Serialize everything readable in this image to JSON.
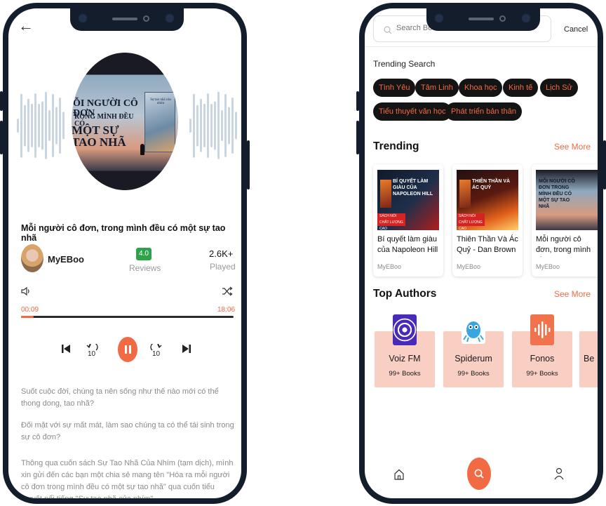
{
  "player": {
    "cover": {
      "line1": "ỖI NGƯỜI CÔ ĐƠN",
      "line2": "RONG MÌNH ĐỀU CÓ",
      "line3": "MỘT SỰ TAO NHÃ"
    },
    "track_title": "Mỗi người cô đơn, trong mình đều có một sự tao nhã",
    "author": "MyEBoo",
    "rating_value": "4.0",
    "rating_label": "Reviews",
    "played_count": "2.6K+",
    "played_label": "Played",
    "time_current": "00:09",
    "time_total": "18:06",
    "progress": 0.06,
    "skip_back_seconds": "10",
    "skip_forward_seconds": "10",
    "description": [
      "Suốt cuộc đời, chúng ta nên sống như thế nào mới có thể thong dong, tao nhã?",
      "Đối mặt với sự mất mát, làm sao chúng ta có thể tái sinh trong sự cô đơn?",
      "Thông qua cuốn sách Sự Tao Nhã Của Nhím (tạm dịch), mình xin gửi đến các bạn một chia sẻ mang tên \"Hóa ra mỗi người cô đơn trong mình đều có một sự tao nhã\" qua cuốn tiểu thuyết nổi tiếng \"Sự tao nhã của nhím\""
    ],
    "accent": "#f26a44",
    "rating_color": "#2fa34a"
  },
  "search": {
    "placeholder": "Search Book & Author Name",
    "cancel_label": "Cancel",
    "trending_search_title": "Trending Search",
    "chips": [
      "Tình Yêu",
      "Tâm Linh",
      "Khoa học",
      "Kinh tế",
      "Lịch Sử",
      "Tiểu thuyết văn học",
      "Phát triển bản thân"
    ],
    "trending_title": "Trending",
    "trending_see_more": "See More",
    "books": [
      {
        "title": "Bí quyết làm giàu của Napoleon Hill",
        "author": "MyEBoo",
        "cover_text": "BÍ QUYẾT LÀM GIÀU CỦA NAPOLEON HILL",
        "badge": "SÁCH NÓI CHẤT LƯỢNG CAO"
      },
      {
        "title": "Thiên Thần Và Ác Quỷ - Dan Brown",
        "author": "MyEBoo",
        "cover_text": "THIÊN THẦN VÀ ÁC QUỶ",
        "badge": "SÁCH NÓI CHẤT LƯỢNG CAO"
      },
      {
        "title": "Mỗi người cô đơn, trong mình đều có ...",
        "author": "MyEBoo",
        "cover_text": "MỖI NGƯỜI CÔ ĐƠN TRONG MÌNH ĐỀU CÓ MỘT SỰ TAO NHÃ",
        "badge": ""
      }
    ],
    "top_authors_title": "Top Authors",
    "authors_see_more": "See More",
    "authors": [
      {
        "name": "Voiz FM",
        "count": "99+ Books"
      },
      {
        "name": "Spiderum",
        "count": "99+ Books"
      },
      {
        "name": "Fonos",
        "count": "99+ Books"
      },
      {
        "name": "Be",
        "count": ""
      }
    ]
  },
  "nav": {
    "icons": [
      "home-icon",
      "search-icon",
      "user-icon"
    ]
  }
}
